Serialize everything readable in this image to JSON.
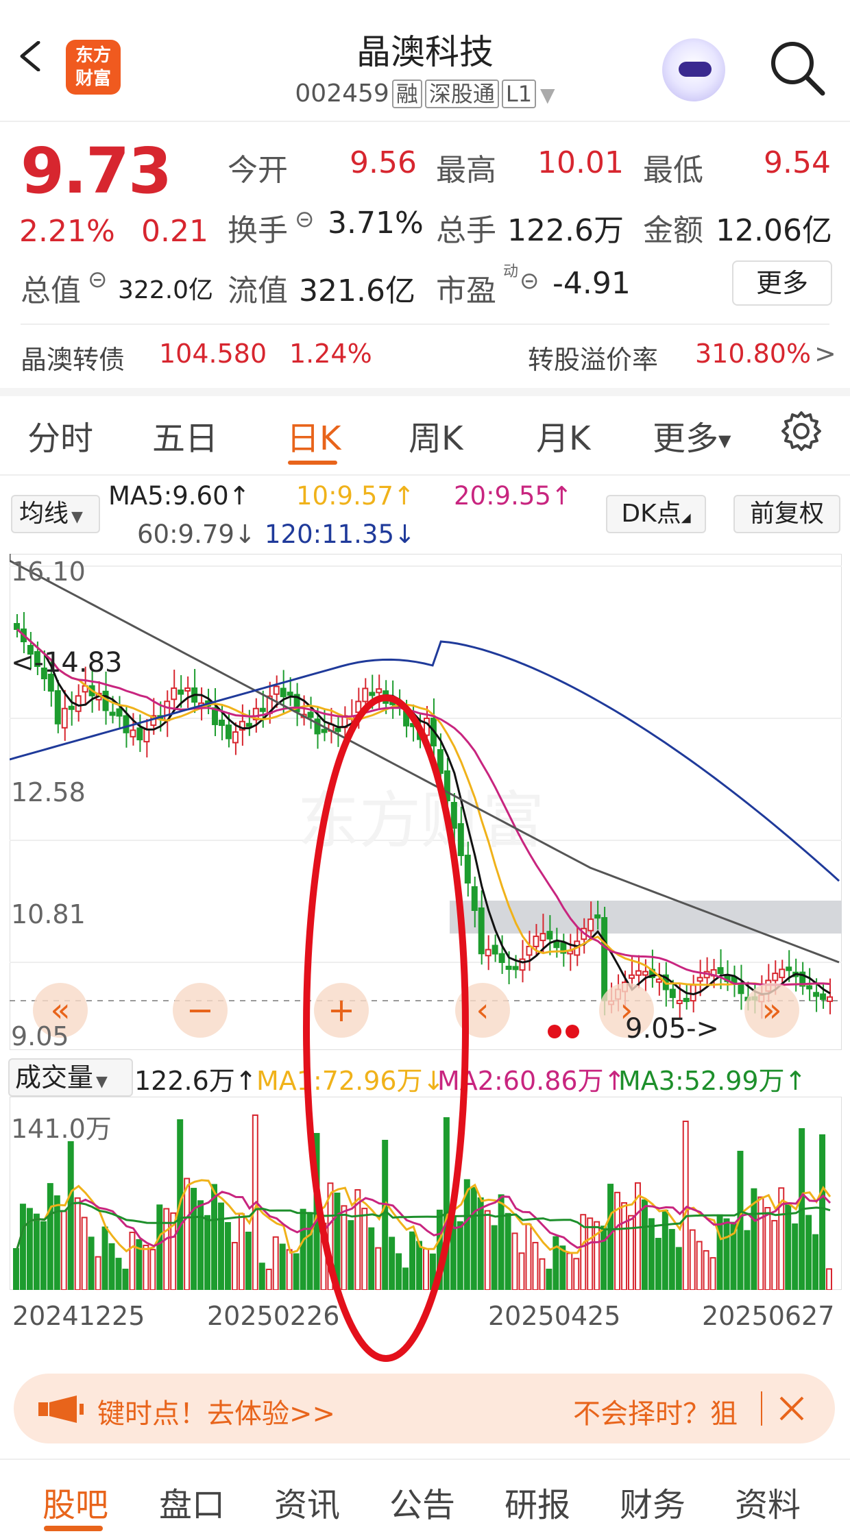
{
  "header": {
    "title": "晶澳科技",
    "code": "002459",
    "tags": [
      "融",
      "深股通",
      "L1"
    ],
    "logo_text": [
      "东方",
      "财富"
    ]
  },
  "quote": {
    "price": "9.73",
    "change_pct": "2.21%",
    "change_amt": "0.21",
    "open_label": "今开",
    "open": "9.56",
    "high_label": "最高",
    "high": "10.01",
    "low_label": "最低",
    "low": "9.54",
    "turnover_label": "换手",
    "turnover": "3.71%",
    "volume_label": "总手",
    "volume": "122.6万",
    "amount_label": "金额",
    "amount": "12.06亿",
    "mktcap_label": "总值",
    "mktcap": "322.0亿",
    "float_label": "流值",
    "float": "321.6亿",
    "pe_label": "市盈",
    "pe_sup": "动",
    "pe": "-4.91",
    "more_label": "更多"
  },
  "bond": {
    "name": "晶澳转债",
    "price": "104.580",
    "pct": "1.24%",
    "premium_label": "转股溢价率",
    "premium": "310.80%",
    "arrow": ">"
  },
  "tabs": [
    "分时",
    "五日",
    "日K",
    "周K",
    "月K",
    "更多"
  ],
  "active_tab": "日K",
  "ma_bar": {
    "button": "均线",
    "ma5": "MA5:9.60↑",
    "ma10": "10:9.57↑",
    "ma20": "20:9.55↑",
    "ma60": "60:9.79↓",
    "ma120": "120:11.35↓",
    "dk_button": "DK点",
    "adjust_button": "前复权"
  },
  "price_axis": {
    "labels": [
      "16.10",
      "12.58",
      "10.81",
      "9.05"
    ],
    "high_marker": "<-14.83",
    "low_marker": "9.05->"
  },
  "volume_bar": {
    "button": "成交量",
    "volume": "122.6万↑",
    "ma1": "MA1:72.96万↓",
    "ma2": "MA2:60.86万↑",
    "ma3": "MA3:52.99万↑",
    "axis_max": "141.0万"
  },
  "dates": [
    "20241225",
    "20250226",
    "20250425",
    "20250627"
  ],
  "banner": {
    "left_text": "键时点！去体验>>",
    "right_text": "不会择时？狙"
  },
  "bottom_tabs": [
    "股吧",
    "盘口",
    "资讯",
    "公告",
    "研报",
    "财务",
    "资料"
  ],
  "colors": {
    "up": "#d7262f",
    "down": "#1d9c2e",
    "ma5": "#111111",
    "ma10": "#f0b21a",
    "ma20": "#c8257f",
    "ma60": "#555555",
    "ma120": "#1f3a9a",
    "accent": "#e8641b"
  },
  "chart_data": {
    "type": "candlestick",
    "x_range": [
      "20241225",
      "20250627"
    ],
    "y_labels": [
      "16.10",
      "12.58",
      "10.81",
      "9.05"
    ],
    "ma": {
      "MA5": 9.6,
      "MA10": 9.57,
      "MA20": 9.55,
      "MA60": 9.79,
      "MA120": 11.35
    },
    "last_price": 9.73,
    "period_high": 14.83,
    "period_low": 9.05
  }
}
